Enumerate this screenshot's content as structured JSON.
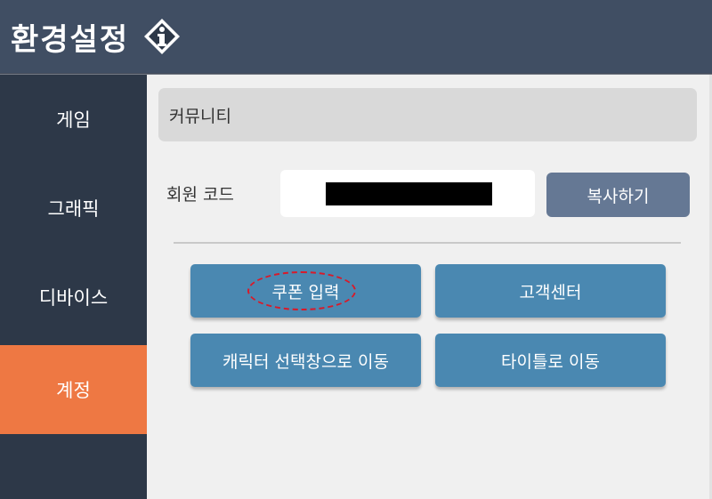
{
  "header": {
    "title": "환경설정",
    "info_icon": "info-diamond-icon"
  },
  "sidebar": {
    "items": [
      {
        "label": "게임",
        "active": false
      },
      {
        "label": "그래픽",
        "active": false
      },
      {
        "label": "디바이스",
        "active": false
      },
      {
        "label": "계정",
        "active": true
      }
    ]
  },
  "content": {
    "section_title": "커뮤니티",
    "member_code_label": "회원 코드",
    "member_code_value": "",
    "copy_button_label": "복사하기",
    "buttons": {
      "coupon": "쿠폰 입력",
      "support": "고객센터",
      "character_select": "캐릭터 선택창으로 이동",
      "title": "타이틀로 이동"
    }
  },
  "colors": {
    "header_bg": "#404e63",
    "sidebar_bg": "#2d3848",
    "active_tab": "#ee7843",
    "action_button": "#4a88b1",
    "copy_button": "#657894",
    "highlight_circle": "#d81a2a"
  }
}
